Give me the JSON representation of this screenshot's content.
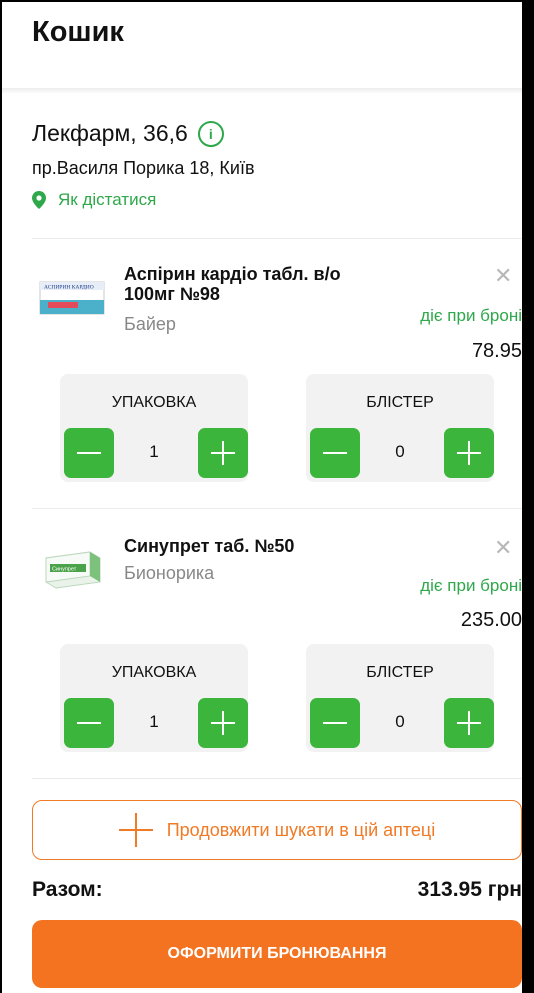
{
  "header": {
    "title": "Кошик"
  },
  "store": {
    "name": "Лекфарм, 36,6",
    "info_icon": "info-icon",
    "address": "пр.Василя Порика 18, Київ",
    "directions_label": "Як дістатися"
  },
  "products": [
    {
      "name": "Аспірин кардіо табл. в/о 100мг №98",
      "maker": "Байер",
      "reserve_note": "діє при броні",
      "price": "78.95",
      "package_label": "УПАКОВКА",
      "package_qty": "1",
      "blister_label": "БЛІСТЕР",
      "blister_qty": "0",
      "image_label": "АСПИРИН КАРДИО"
    },
    {
      "name": "Синупрет таб. №50",
      "maker": "Бионорика",
      "reserve_note": "діє при броні",
      "price": "235.00",
      "package_label": "УПАКОВКА",
      "package_qty": "1",
      "blister_label": "БЛІСТЕР",
      "blister_qty": "0",
      "image_label": "Синупрет"
    }
  ],
  "continue_button": "Продовжити шукати в цій аптеці",
  "total": {
    "label": "Разом:",
    "value": "313.95 грн"
  },
  "book_button": "ОФОРМИТИ БРОНЮВАННЯ",
  "colors": {
    "green": "#3bb53b",
    "orange": "#f47320",
    "text_green": "#2ea84a"
  }
}
